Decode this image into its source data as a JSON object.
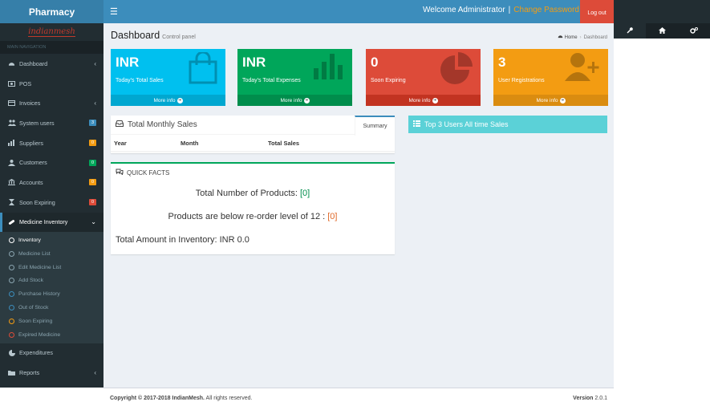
{
  "app": {
    "logo": "Pharmacy",
    "brand": "indianmesh"
  },
  "sidebar": {
    "nav_header": "MAIN NAVIGATION",
    "items": [
      {
        "label": "Dashboard",
        "icon": "dashboard-icon",
        "arrow": "‹"
      },
      {
        "label": "POS",
        "icon": "pos-icon"
      },
      {
        "label": "Invoices",
        "icon": "invoice-icon",
        "arrow": "‹"
      },
      {
        "label": "System users",
        "icon": "users-icon",
        "badge": "3",
        "badge_color": "#3c8dbc"
      },
      {
        "label": "Suppliers",
        "icon": "suppliers-icon",
        "badge": "0",
        "badge_color": "#f39c12"
      },
      {
        "label": "Customers",
        "icon": "customers-icon",
        "badge": "0",
        "badge_color": "#00a65a"
      },
      {
        "label": "Accounts",
        "icon": "bank-icon",
        "badge": "0",
        "badge_color": "#f39c12"
      },
      {
        "label": "Soon Expiring",
        "icon": "hourglass-icon",
        "badge": "0",
        "badge_color": "#dd4b39"
      },
      {
        "label": "Medicine Inventory",
        "icon": "medicine-icon",
        "arrow": "⌄"
      }
    ],
    "submenu": [
      {
        "label": "Inventory",
        "color": "#ffffff"
      },
      {
        "label": "Medicine List",
        "color": "#8aa4af"
      },
      {
        "label": "Edit Medicine List",
        "color": "#8aa4af"
      },
      {
        "label": "Add Stock",
        "color": "#8aa4af"
      },
      {
        "label": "Purchase History",
        "color": "#3c8dbc"
      },
      {
        "label": "Out of Stock",
        "color": "#3c8dbc"
      },
      {
        "label": "Soon Expiring",
        "color": "#f39c12"
      },
      {
        "label": "Expired Medicine",
        "color": "#dd4b39"
      }
    ],
    "bottom_items": [
      {
        "label": "Expenditures",
        "icon": "pie-icon"
      },
      {
        "label": "Reports",
        "icon": "folder-icon",
        "arrow": "‹"
      }
    ]
  },
  "header": {
    "toggle_icon": "menu-icon",
    "welcome": "Welcome Administrator",
    "separator": "|",
    "change_password": "Change Password",
    "logout": "Log out"
  },
  "control_sidebar": {
    "tabs": [
      "wrench-icon",
      "home-icon",
      "gears-icon"
    ]
  },
  "page": {
    "title": "Dashboard",
    "subtitle": "Control panel",
    "breadcrumb_home": "Home",
    "breadcrumb_sep": "›",
    "breadcrumb_current": "Dashboard"
  },
  "boxes": [
    {
      "number": "INR",
      "label": "Today's Total Sales",
      "more": "More info",
      "color": "#00c0ef",
      "footer": "#00a7d0",
      "icon": "shopping-bag-icon"
    },
    {
      "number": "INR",
      "label": "Today's Total Expenses",
      "more": "More info",
      "color": "#00a65a",
      "footer": "#008d4c",
      "icon": "bar-chart-icon"
    },
    {
      "number": "0",
      "label": "Soon Expiring",
      "more": "More info",
      "color": "#dd4b39",
      "footer": "#c23321",
      "icon": "pie-chart-icon"
    },
    {
      "number": "3",
      "label": "User Registrations",
      "more": "More info",
      "color": "#f39c12",
      "footer": "#da8c10",
      "icon": "user-add-icon"
    }
  ],
  "monthly_sales": {
    "title": "Total Monthly Sales",
    "tab": "Summary",
    "columns": [
      "Year",
      "Month",
      "Total Sales"
    ]
  },
  "quick_facts": {
    "title": "QUICK FACTS",
    "products_label": "Total Number of Products:",
    "products_value": "[0]",
    "reorder_label": "Products are below re-order level of 12 :",
    "reorder_value": "[0]",
    "amount_label": "Total Amount in Inventory: INR 0.0"
  },
  "top_users": {
    "title": "Top 3 Users All time Sales"
  },
  "footer": {
    "copyright": "Copyright © 2017-2018 IndianMesh.",
    "rights": "All rights reserved.",
    "version_label": "Version",
    "version": "2.0.1"
  }
}
